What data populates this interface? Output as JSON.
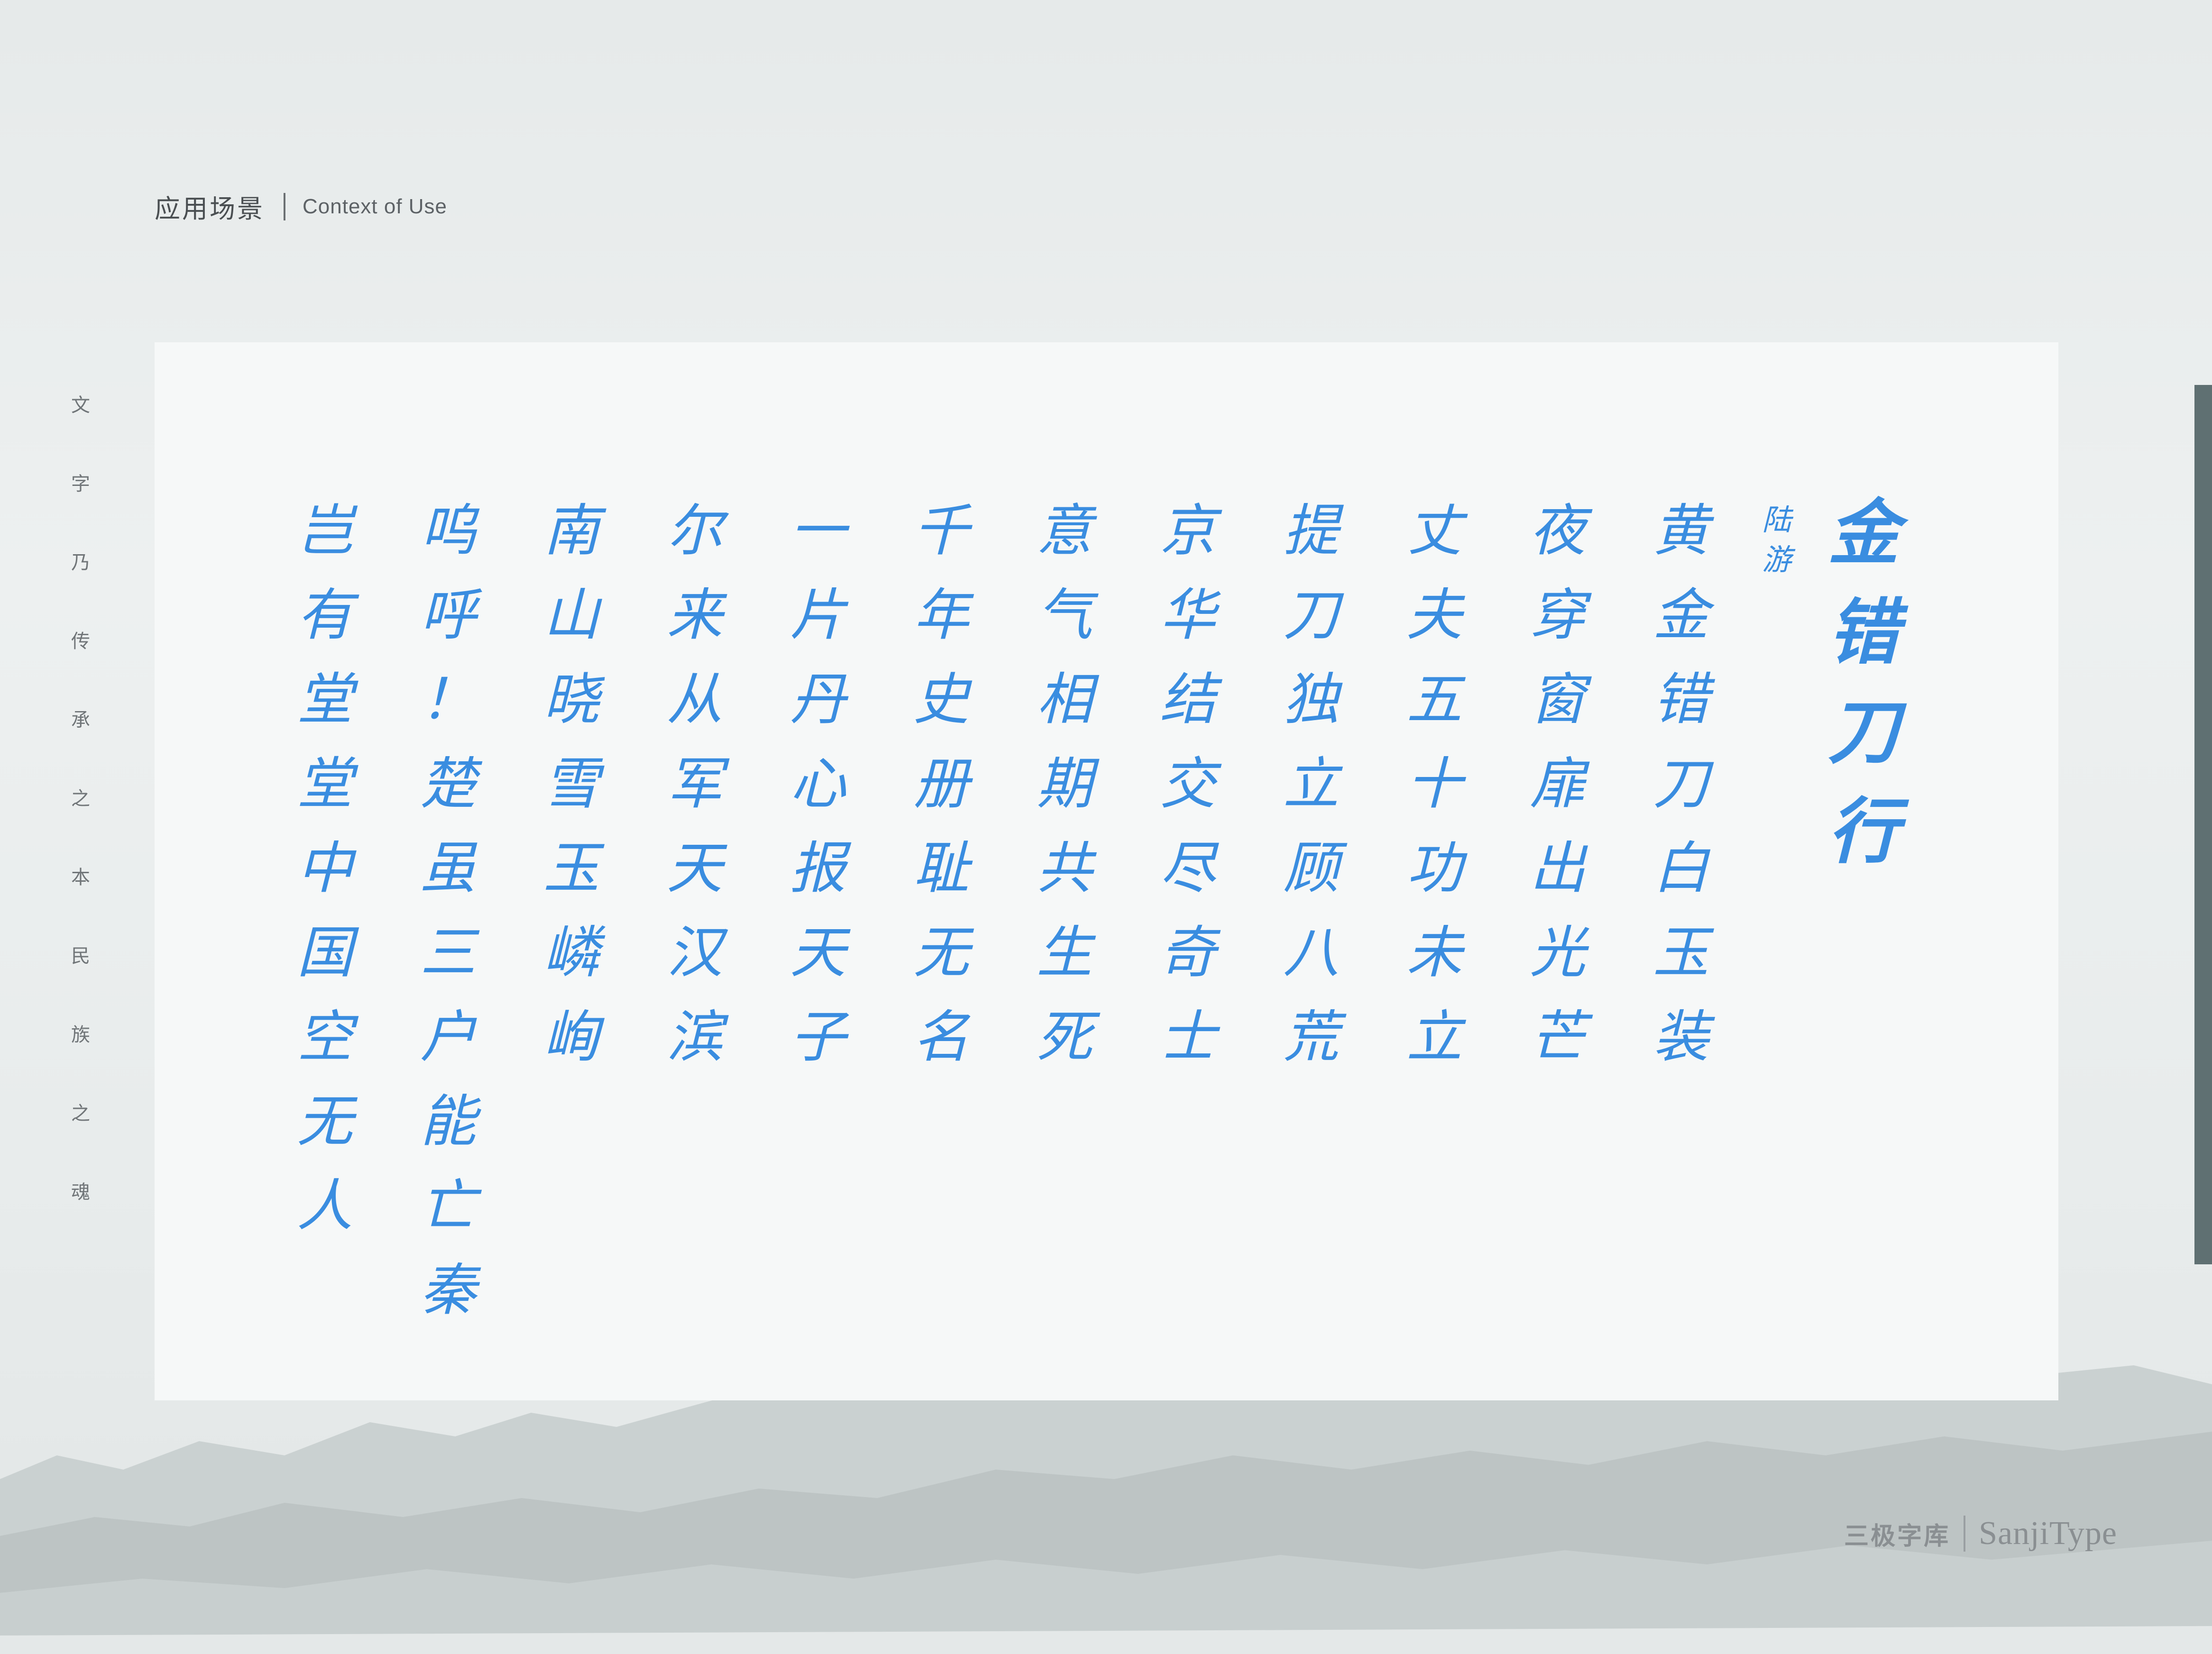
{
  "header": {
    "title_zh": "应用场景",
    "title_en": "Context of Use"
  },
  "side_text": [
    "文",
    "字",
    "乃",
    "传",
    "承",
    "之",
    "本",
    "民",
    "族",
    "之",
    "魂"
  ],
  "poem": {
    "title": [
      "金",
      "错",
      "刀",
      "行"
    ],
    "author": [
      "陆",
      "游"
    ],
    "columns": [
      [
        "黄",
        "金",
        "错",
        "刀",
        "白",
        "玉",
        "装"
      ],
      [
        "夜",
        "穿",
        "窗",
        "扉",
        "出",
        "光",
        "芒"
      ],
      [
        "丈",
        "夫",
        "五",
        "十",
        "功",
        "未",
        "立"
      ],
      [
        "提",
        "刀",
        "独",
        "立",
        "顾",
        "八",
        "荒"
      ],
      [
        "京",
        "华",
        "结",
        "交",
        "尽",
        "奇",
        "士"
      ],
      [
        "意",
        "气",
        "相",
        "期",
        "共",
        "生",
        "死"
      ],
      [
        "千",
        "年",
        "史",
        "册",
        "耻",
        "无",
        "名"
      ],
      [
        "一",
        "片",
        "丹",
        "心",
        "报",
        "天",
        "子"
      ],
      [
        "尔",
        "来",
        "从",
        "军",
        "天",
        "汉",
        "滨"
      ],
      [
        "南",
        "山",
        "晓",
        "雪",
        "玉",
        "嶙",
        "峋"
      ],
      [
        "呜",
        "呼",
        "！",
        "楚",
        "虽",
        "三",
        "户",
        "能",
        "亡",
        "秦"
      ],
      [
        "岂",
        "有",
        "堂",
        "堂",
        "中",
        "国",
        "空",
        "无",
        "人"
      ]
    ]
  },
  "brand": {
    "name_zh": "三极字库",
    "name_en": "SanjiType"
  },
  "colors": {
    "poem_text": "#3a8de0",
    "card_bg": "#f6f8f8",
    "accent_bar": "#5f7072",
    "background": "#e9eded"
  }
}
